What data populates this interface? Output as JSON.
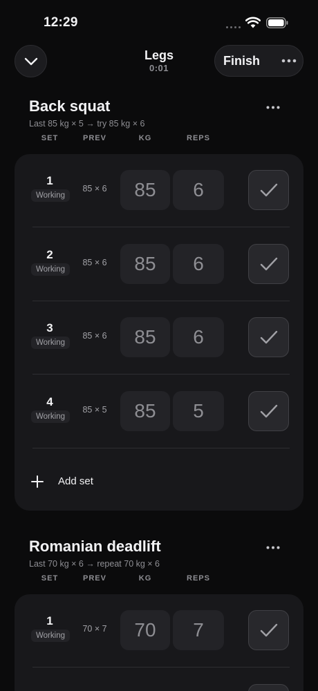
{
  "status_bar": {
    "time": "12:29"
  },
  "header": {
    "title": "Legs",
    "timer": "0:01",
    "finish_label": "Finish"
  },
  "columns": {
    "set": "SET",
    "prev": "PREV",
    "kg": "KG",
    "reps": "REPS"
  },
  "exercises": [
    {
      "name": "Back squat",
      "hint": "Last 85 kg × 5 → try 85 kg × 6",
      "sets": [
        {
          "number": "1",
          "type": "Working",
          "prev": "85 × 6",
          "kg": "85",
          "reps": "6"
        },
        {
          "number": "2",
          "type": "Working",
          "prev": "85 × 6",
          "kg": "85",
          "reps": "6"
        },
        {
          "number": "3",
          "type": "Working",
          "prev": "85 × 6",
          "kg": "85",
          "reps": "6"
        },
        {
          "number": "4",
          "type": "Working",
          "prev": "85 × 5",
          "kg": "85",
          "reps": "5"
        }
      ],
      "add_set_label": "Add set"
    },
    {
      "name": "Romanian deadlift",
      "hint": "Last 70 kg × 6 → repeat 70 kg × 6",
      "sets": [
        {
          "number": "1",
          "type": "Working",
          "prev": "70 × 7",
          "kg": "70",
          "reps": "7"
        }
      ]
    }
  ],
  "icons": {
    "collapse": "chevron-down-icon",
    "more": "more-horizontal-icon",
    "check": "checkmark-icon",
    "add": "plus-icon"
  },
  "colors": {
    "background": "#0b0b0c",
    "card": "#18181b",
    "field": "#232327",
    "text": "#f2f2f4",
    "muted": "#8e8e93"
  }
}
